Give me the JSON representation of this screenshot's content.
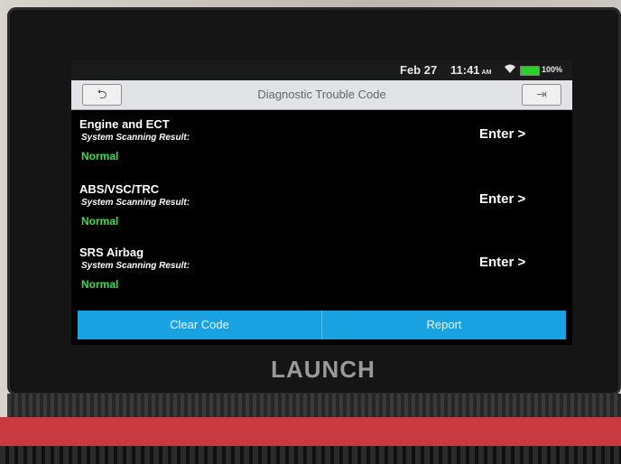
{
  "status": {
    "date": "Feb 27",
    "time": "11:41",
    "ampm": "AM",
    "battery_text": "100%",
    "battery_level": 1.0,
    "wifi_icon": "wifi-icon",
    "battery_icon": "battery-icon",
    "battery_color": "#2bd12b"
  },
  "header": {
    "title": "Diagnostic Trouble Code",
    "back_icon": "back-arrow-icon",
    "exit_icon": "exit-icon"
  },
  "systems": [
    {
      "name": "Engine and ECT",
      "label": "System Scanning Result:",
      "status": "Normal",
      "action": "Enter >"
    },
    {
      "name": "ABS/VSC/TRC",
      "label": "System Scanning Result:",
      "status": "Normal",
      "action": "Enter >"
    },
    {
      "name": "SRS Airbag",
      "label": "System Scanning Result:",
      "status": "Normal",
      "action": "Enter >"
    }
  ],
  "footer": {
    "clear_label": "Clear Code",
    "report_label": "Report",
    "accent": "#19a2e2"
  },
  "device": {
    "brand": "LAUNCH"
  }
}
